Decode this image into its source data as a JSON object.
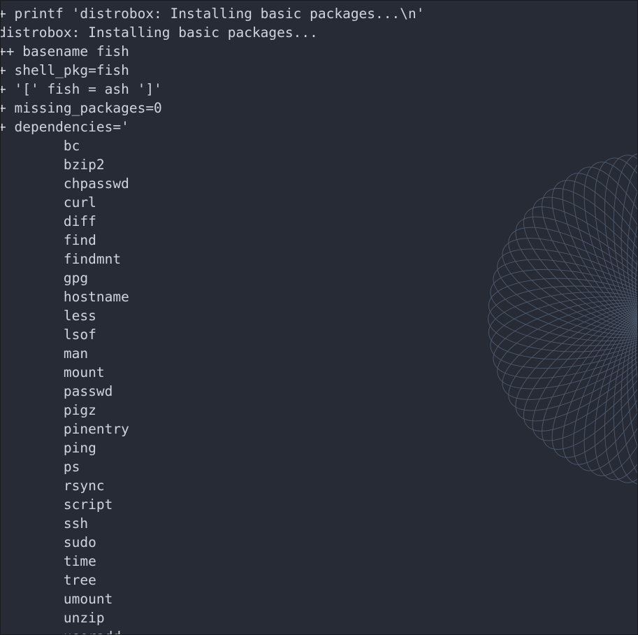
{
  "terminal": {
    "lines": [
      "+ printf 'distrobox: Installing basic packages...\\n'",
      "distrobox: Installing basic packages...",
      "++ basename fish",
      "+ shell_pkg=fish",
      "+ '[' fish = ash ']'",
      "+ missing_packages=0",
      "+ dependencies='",
      "        bc",
      "        bzip2",
      "        chpasswd",
      "        curl",
      "        diff",
      "        find",
      "        findmnt",
      "        gpg",
      "        hostname",
      "        less",
      "        lsof",
      "        man",
      "        mount",
      "        passwd",
      "        pigz",
      "        pinentry",
      "        ping",
      "        ps",
      "        rsync",
      "        script",
      "        ssh",
      "        sudo",
      "        time",
      "        tree",
      "        umount",
      "        unzip",
      "        useradd"
    ]
  },
  "colors": {
    "background": "#272b35",
    "foreground": "#d0d4dc",
    "wallpaper_lines": "#5a6a80"
  }
}
